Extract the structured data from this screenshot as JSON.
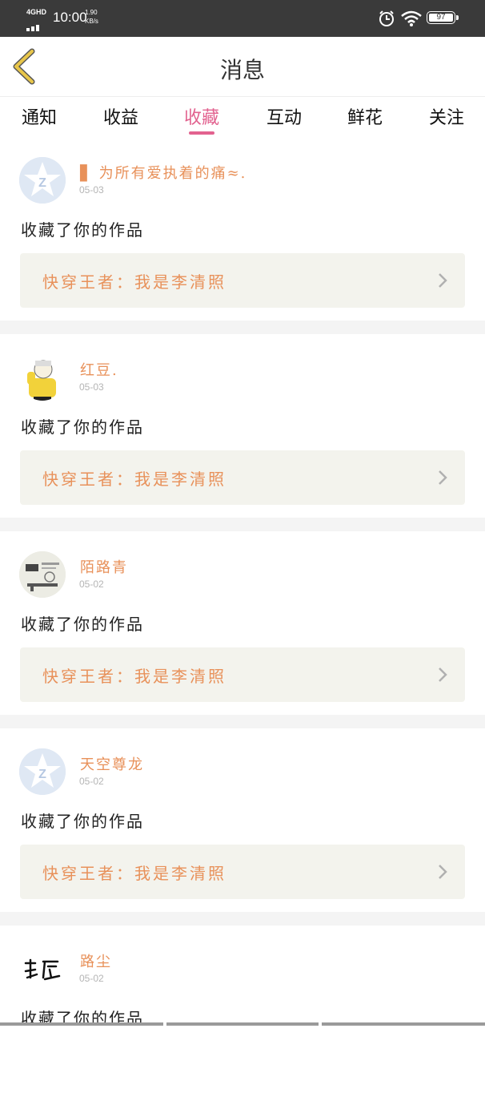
{
  "status_bar": {
    "network": "4GHD",
    "time": "10:00",
    "speed_value": "1.90",
    "speed_unit": "KB/s",
    "battery": "97",
    "icons": [
      "signal-icon",
      "alarm-icon",
      "wifi-icon",
      "battery-icon"
    ]
  },
  "header": {
    "title": "消息",
    "back_icon": "chevron-left-icon"
  },
  "tabs": [
    {
      "label": "通知"
    },
    {
      "label": "收益"
    },
    {
      "label": "收藏"
    },
    {
      "label": "互动"
    },
    {
      "label": "鲜花"
    },
    {
      "label": "关注"
    }
  ],
  "active_tab": "收藏",
  "colors": {
    "accent": "#e2628f",
    "orange_text": "#e8915a",
    "status_bar": "#3a3a3a",
    "work_box_bg": "#f3f3ed",
    "back_icon": "#e8c64a"
  },
  "notifications": [
    {
      "username": "▋ 为所有爱执着的痛≈.",
      "date": "05-03",
      "action": "收藏了你的作品",
      "work_title": "快穿王者：我是李清照",
      "avatar": "default-qq-avatar"
    },
    {
      "username": "红豆.",
      "date": "05-03",
      "action": "收藏了你的作品",
      "work_title": "快穿王者：我是李清照",
      "avatar": "yellow-hoodie-character-avatar"
    },
    {
      "username": "陌路青",
      "date": "05-02",
      "action": "收藏了你的作品",
      "work_title": "快穿王者：我是李清照",
      "avatar": "calligraphy-scene-avatar"
    },
    {
      "username": "天空尊龙",
      "date": "05-02",
      "action": "收藏了你的作品",
      "work_title": "快穿王者：我是李清照",
      "avatar": "default-qq-avatar"
    },
    {
      "username": "路尘",
      "date": "05-02",
      "action": "收藏了你的作品",
      "work_title": "",
      "avatar": "calligraphy-text-avatar"
    }
  ]
}
